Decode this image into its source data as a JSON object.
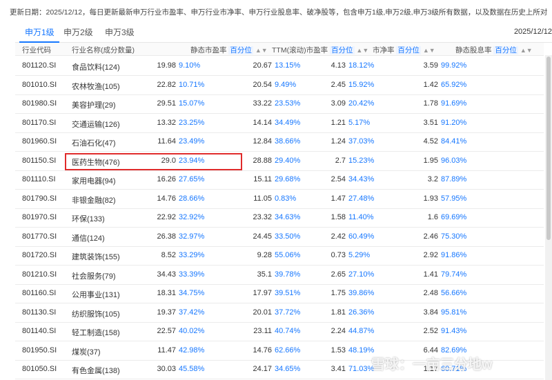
{
  "notice": "更新日期：2025/12/12，每日更新最新申万行业市盈率、申万行业市净率、申万行业股息率、破净股等，包含申万1级,申万2级,申万3级所有数据，以及数据在历史上所对应的百分位数。",
  "tabs": [
    {
      "label": "申万1级"
    },
    {
      "label": "申万2级"
    },
    {
      "label": "申万3级"
    }
  ],
  "date": "2025/12/12",
  "headers": {
    "code": "行业代码",
    "name": "行业名称(成分数量)",
    "pe": "静态市盈率",
    "ttm": "TTM(滚动)市盈率",
    "pb": "市净率",
    "dy": "静态股息率",
    "pct": "百分位",
    "sort": "▲▼"
  },
  "rows": [
    {
      "code": "801120.SI",
      "name": "食品饮料(124)",
      "pe": "19.98",
      "pe_pct": "9.10%",
      "ttm": "20.67",
      "ttm_pct": "13.15%",
      "pb": "4.13",
      "pb_pct": "18.12%",
      "dy": "3.59",
      "dy_pct": "99.92%"
    },
    {
      "code": "801010.SI",
      "name": "农林牧渔(105)",
      "pe": "22.82",
      "pe_pct": "10.71%",
      "ttm": "20.54",
      "ttm_pct": "9.49%",
      "pb": "2.45",
      "pb_pct": "15.92%",
      "dy": "1.42",
      "dy_pct": "65.92%"
    },
    {
      "code": "801980.SI",
      "name": "美容护理(29)",
      "pe": "29.51",
      "pe_pct": "15.07%",
      "ttm": "33.22",
      "ttm_pct": "23.53%",
      "pb": "3.09",
      "pb_pct": "20.42%",
      "dy": "1.78",
      "dy_pct": "91.69%"
    },
    {
      "code": "801170.SI",
      "name": "交通运输(126)",
      "pe": "13.32",
      "pe_pct": "23.25%",
      "ttm": "14.14",
      "ttm_pct": "34.49%",
      "pb": "1.21",
      "pb_pct": "5.17%",
      "dy": "3.51",
      "dy_pct": "91.20%"
    },
    {
      "code": "801960.SI",
      "name": "石油石化(47)",
      "pe": "11.64",
      "pe_pct": "23.49%",
      "ttm": "12.84",
      "ttm_pct": "38.66%",
      "pb": "1.24",
      "pb_pct": "37.03%",
      "dy": "4.52",
      "dy_pct": "84.41%"
    },
    {
      "code": "801150.SI",
      "name": "医药生物(476)",
      "pe": "29.0",
      "pe_pct": "23.94%",
      "ttm": "28.88",
      "ttm_pct": "29.40%",
      "pb": "2.7",
      "pb_pct": "15.23%",
      "dy": "1.95",
      "dy_pct": "96.03%"
    },
    {
      "code": "801110.SI",
      "name": "家用电器(94)",
      "pe": "16.26",
      "pe_pct": "27.65%",
      "ttm": "15.11",
      "ttm_pct": "29.68%",
      "pb": "2.54",
      "pb_pct": "34.43%",
      "dy": "3.2",
      "dy_pct": "87.89%"
    },
    {
      "code": "801790.SI",
      "name": "非银金融(82)",
      "pe": "14.76",
      "pe_pct": "28.66%",
      "ttm": "11.05",
      "ttm_pct": "0.83%",
      "pb": "1.47",
      "pb_pct": "27.48%",
      "dy": "1.93",
      "dy_pct": "57.95%"
    },
    {
      "code": "801970.SI",
      "name": "环保(133)",
      "pe": "22.92",
      "pe_pct": "32.92%",
      "ttm": "23.32",
      "ttm_pct": "34.63%",
      "pb": "1.58",
      "pb_pct": "11.40%",
      "dy": "1.6",
      "dy_pct": "69.69%"
    },
    {
      "code": "801770.SI",
      "name": "通信(124)",
      "pe": "26.38",
      "pe_pct": "32.97%",
      "ttm": "24.45",
      "ttm_pct": "33.50%",
      "pb": "2.42",
      "pb_pct": "60.49%",
      "dy": "2.46",
      "dy_pct": "75.30%"
    },
    {
      "code": "801720.SI",
      "name": "建筑装饰(155)",
      "pe": "8.52",
      "pe_pct": "33.29%",
      "ttm": "9.28",
      "ttm_pct": "55.06%",
      "pb": "0.73",
      "pb_pct": "5.29%",
      "dy": "2.92",
      "dy_pct": "91.86%"
    },
    {
      "code": "801210.SI",
      "name": "社会服务(79)",
      "pe": "34.43",
      "pe_pct": "33.39%",
      "ttm": "35.1",
      "ttm_pct": "39.78%",
      "pb": "2.65",
      "pb_pct": "27.10%",
      "dy": "1.41",
      "dy_pct": "79.74%"
    },
    {
      "code": "801160.SI",
      "name": "公用事业(131)",
      "pe": "18.31",
      "pe_pct": "34.75%",
      "ttm": "17.97",
      "ttm_pct": "39.51%",
      "pb": "1.75",
      "pb_pct": "39.86%",
      "dy": "2.48",
      "dy_pct": "56.66%"
    },
    {
      "code": "801130.SI",
      "name": "纺织服饰(105)",
      "pe": "19.37",
      "pe_pct": "37.42%",
      "ttm": "20.01",
      "ttm_pct": "37.72%",
      "pb": "1.81",
      "pb_pct": "26.36%",
      "dy": "3.84",
      "dy_pct": "95.81%"
    },
    {
      "code": "801140.SI",
      "name": "轻工制造(158)",
      "pe": "22.57",
      "pe_pct": "40.02%",
      "ttm": "23.11",
      "ttm_pct": "40.74%",
      "pb": "2.24",
      "pb_pct": "44.87%",
      "dy": "2.52",
      "dy_pct": "91.43%"
    },
    {
      "code": "801950.SI",
      "name": "煤炭(37)",
      "pe": "11.47",
      "pe_pct": "42.98%",
      "ttm": "14.76",
      "ttm_pct": "62.66%",
      "pb": "1.53",
      "pb_pct": "48.19%",
      "dy": "6.44",
      "dy_pct": "82.69%"
    },
    {
      "code": "801050.SI",
      "name": "有色金属(138)",
      "pe": "30.03",
      "pe_pct": "45.58%",
      "ttm": "24.17",
      "ttm_pct": "34.65%",
      "pb": "3.41",
      "pb_pct": "71.03%",
      "dy": "1.17",
      "dy_pct": "60.71%"
    }
  ],
  "watermark": "雪球：一亩三分地w"
}
